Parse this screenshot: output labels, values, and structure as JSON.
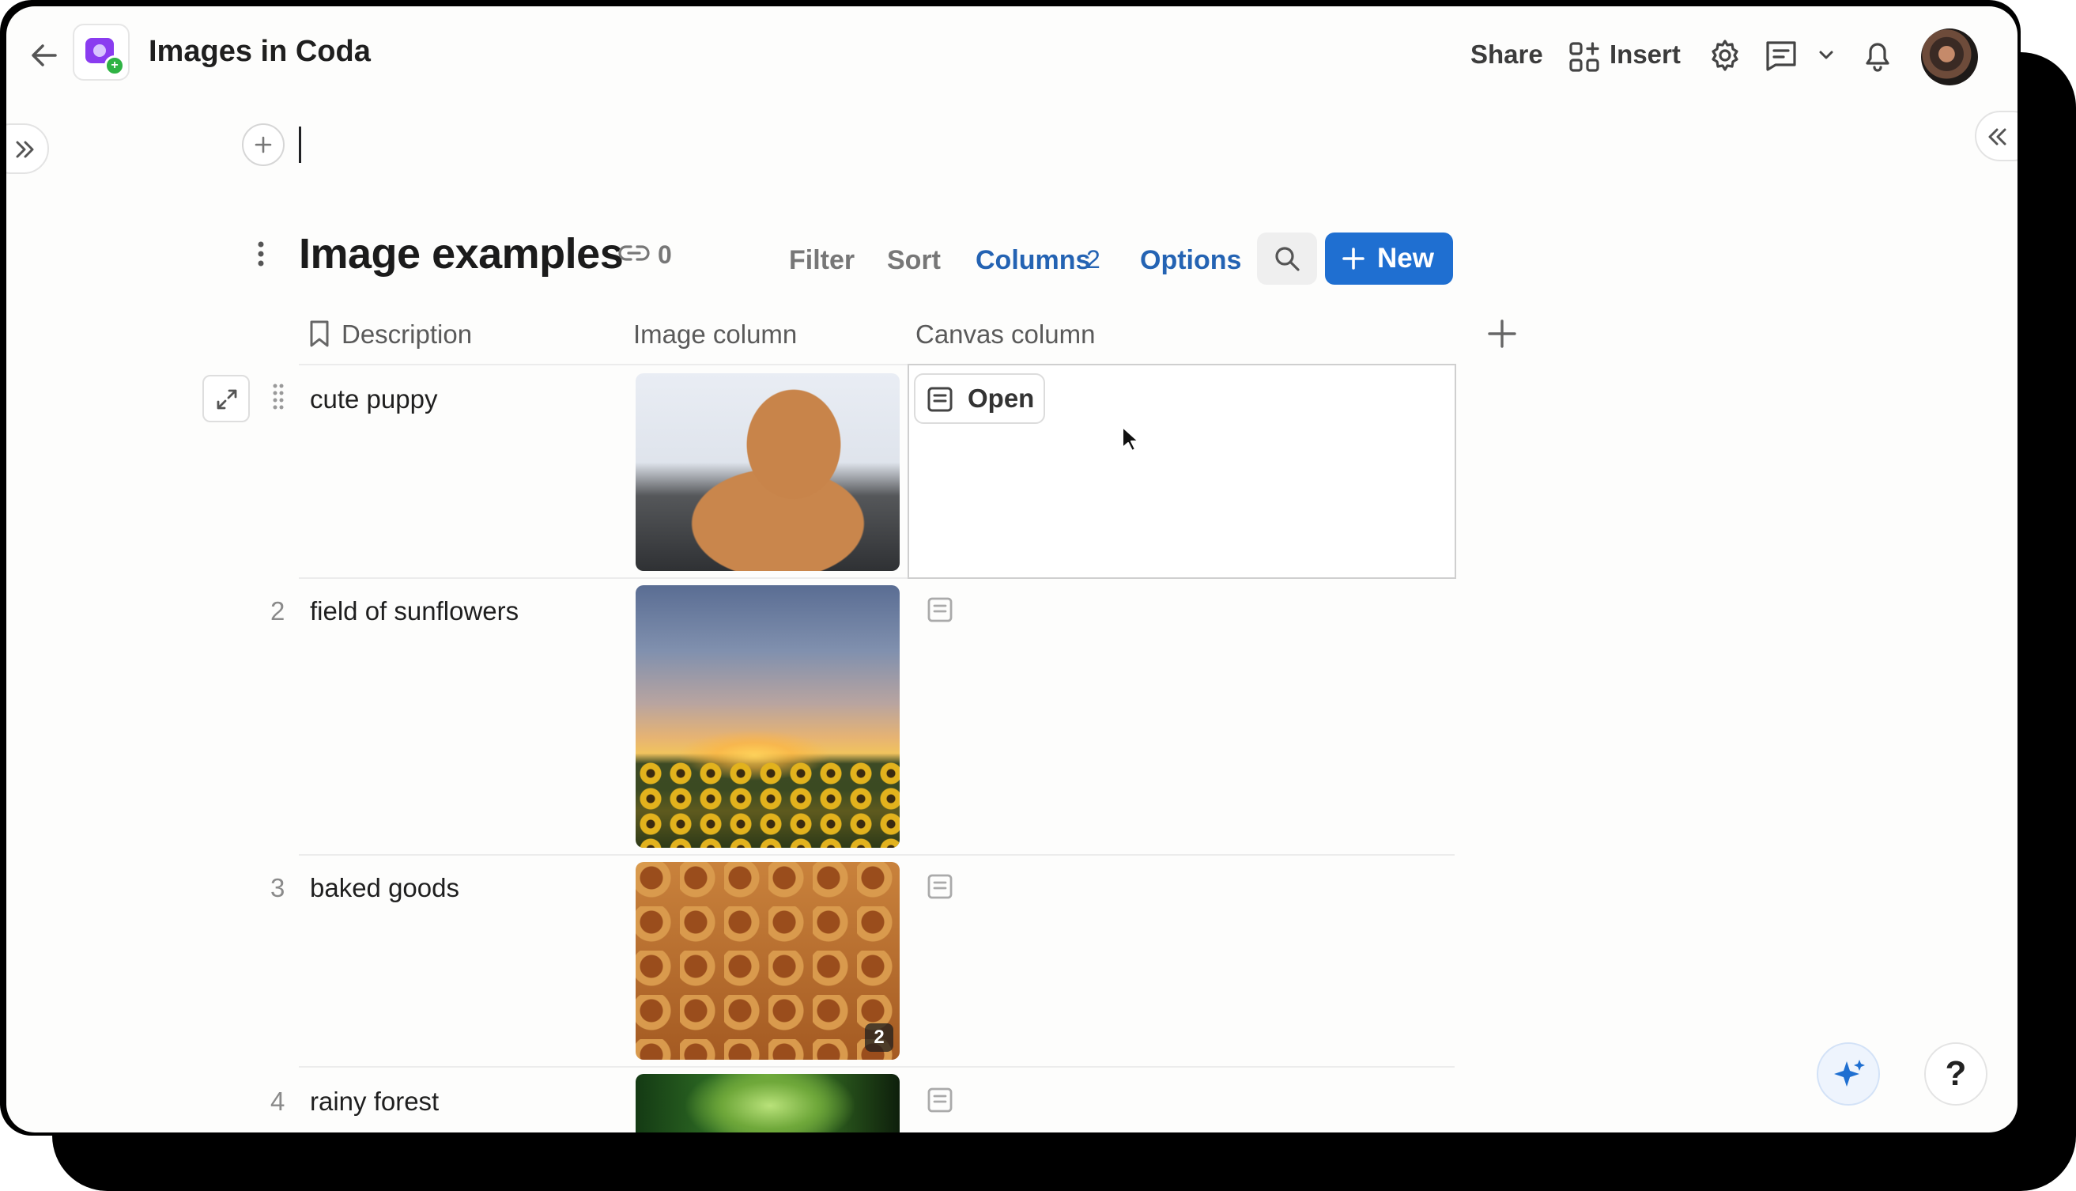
{
  "header": {
    "doc_title": "Images in Coda",
    "share_label": "Share",
    "insert_label": "Insert"
  },
  "table": {
    "title": "Image examples",
    "link_count": "0",
    "toolbar": {
      "filter_label": "Filter",
      "sort_label": "Sort",
      "columns_label": "Columns",
      "columns_count": "2",
      "options_label": "Options",
      "new_label": "New"
    },
    "columns": {
      "description": "Description",
      "image": "Image column",
      "canvas": "Canvas column"
    },
    "rows": [
      {
        "num": "",
        "description": "cute puppy",
        "image": "puppy",
        "canvas_open_label": "Open"
      },
      {
        "num": "2",
        "description": "field of sunflowers",
        "image": "sunflowers"
      },
      {
        "num": "3",
        "description": "baked goods",
        "image": "baked goods",
        "image_count": "2"
      },
      {
        "num": "4",
        "description": "rainy forest",
        "image": "forest"
      }
    ]
  },
  "help_label": "?",
  "colors": {
    "accent": "#1f6fd1",
    "link_blue": "#2463b3",
    "app_icon": "#8a3cf0"
  },
  "icons": [
    "back-arrow-icon",
    "insert-grid-icon",
    "gear-icon",
    "comment-icon",
    "chevron-down-icon",
    "bell-icon",
    "expand-panel-icon",
    "collapse-panel-icon",
    "plus-icon",
    "kebab-icon",
    "link-icon",
    "search-icon",
    "bookmark-icon",
    "expand-row-icon",
    "drag-handle-icon",
    "canvas-doc-icon",
    "sparkle-icon",
    "cursor-icon"
  ]
}
